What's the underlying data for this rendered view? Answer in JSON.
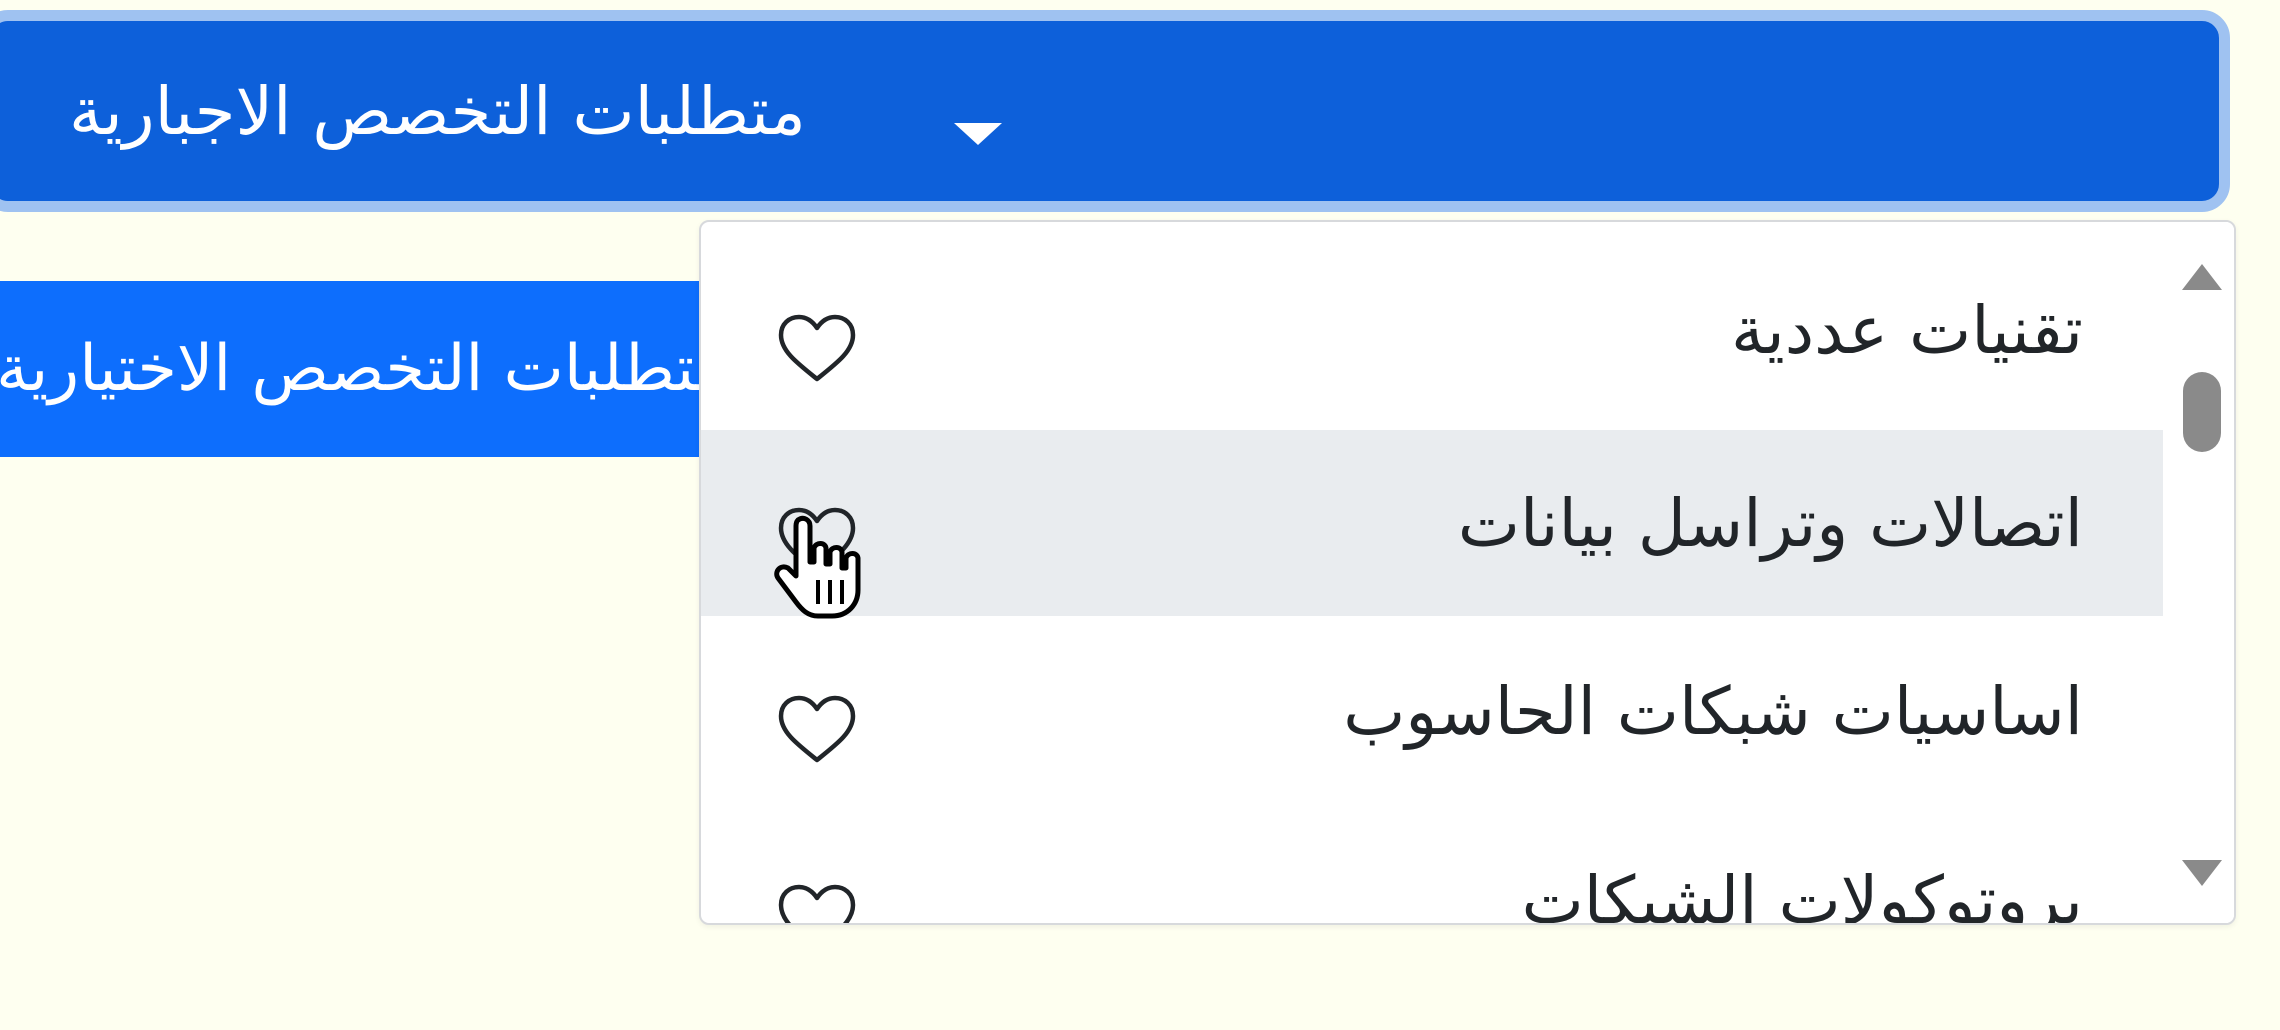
{
  "mandatory_toggle": {
    "label": "متطلبات التخصص الاجبارية",
    "icon": "caret-down-icon"
  },
  "elective_toggle": {
    "label": "متطلبات التخصص الاختيارية"
  },
  "menu": {
    "items": [
      {
        "label": "تقنيات عددية",
        "icon": "heart-outline-icon",
        "hovered": false
      },
      {
        "label": "اتصالات وتراسل بيانات",
        "icon": "heart-outline-icon",
        "hovered": true
      },
      {
        "label": "اساسيات شبكات الحاسوب",
        "icon": "heart-outline-icon",
        "hovered": false
      },
      {
        "label": "بروتوكولات الشبكات",
        "icon": "heart-outline-icon",
        "hovered": false
      }
    ]
  },
  "colors": {
    "primary_active": "#0d60da",
    "primary": "#0d6efd",
    "focus_ring": "#9fc2f1",
    "hover_bg": "#e9ecef",
    "page_bg": "#fefff0"
  }
}
